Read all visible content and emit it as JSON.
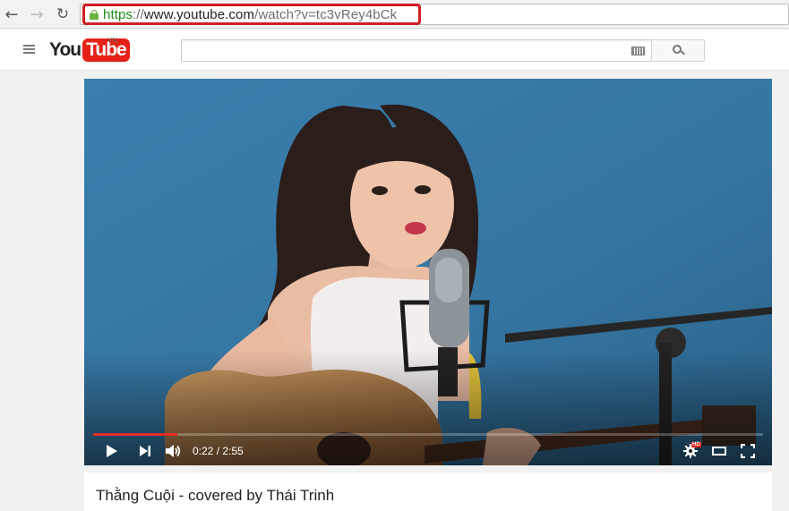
{
  "browser": {
    "back_icon": "arrow-left-icon",
    "forward_icon": "arrow-right-icon",
    "reload_icon": "reload-icon",
    "url_scheme": "https",
    "url_separator": "://",
    "url_host": "www.youtube.com",
    "url_path": "/watch?v=tc3vRey4bCk",
    "url_highlight_color": "#d01d25"
  },
  "header": {
    "logo_you": "You",
    "logo_tube": "Tube",
    "logo_region": "VN",
    "search_placeholder": "",
    "brand_color": "#e62117"
  },
  "player": {
    "current_time": "0:22",
    "duration": "2:55",
    "time_separator": " / ",
    "progress_fraction": 0.126,
    "loaded_fraction": 0.126,
    "quality_badge": "HD",
    "progress_color": "#e52d27"
  },
  "video": {
    "title": "Thằng Cuội - covered by Thái Trinh"
  }
}
